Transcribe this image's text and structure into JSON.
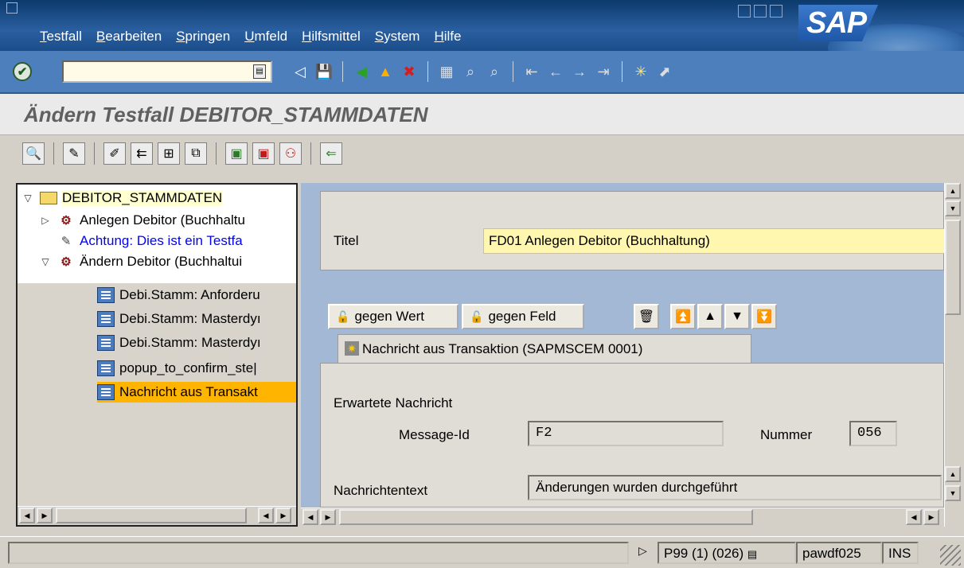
{
  "menu": [
    "Testfall",
    "Bearbeiten",
    "Springen",
    "Umfeld",
    "Hilfsmittel",
    "System",
    "Hilfe"
  ],
  "brand": "SAP",
  "command_field": {
    "value": ""
  },
  "page_title": "Ändern Testfall DEBITOR_STAMMDATEN",
  "tree": {
    "root": "DEBITOR_STAMMDATEN",
    "items": [
      {
        "label": "Anlegen Debitor (Buchhaltu",
        "icon": "gear-icon"
      },
      {
        "label": "Achtung: Dies ist ein Testfa",
        "icon": "pencil-icon",
        "color": "#0000ff"
      },
      {
        "label": "Ändern Debitor (Buchhaltui",
        "icon": "gear-icon"
      },
      {
        "label": "Debi.Stamm: Anforderu",
        "icon": "document-icon"
      },
      {
        "label": "Debi.Stamm: Masterdyı",
        "icon": "document-icon"
      },
      {
        "label": "Debi.Stamm: Masterdyı",
        "icon": "document-icon"
      },
      {
        "label": "popup_to_confirm_ste|",
        "icon": "document-icon"
      },
      {
        "label": "Nachricht aus Transakt",
        "icon": "document-icon",
        "selected": true
      }
    ]
  },
  "detail": {
    "titel_label": "Titel",
    "titel_value": "FD01 Anlegen Debitor (Buchhaltung)",
    "btn_gegen_wert": "gegen Wert",
    "btn_gegen_feld": "gegen Feld",
    "tab_label": "Nachricht aus Transaktion (SAPMSCEM 0001)",
    "erwartete_nachricht": "Erwartete Nachricht",
    "message_id_label": "Message-Id",
    "message_id_value": "F2",
    "nummer_label": "Nummer",
    "nummer_value": "056",
    "nachrichtentext_label": "Nachrichtentext",
    "nachrichtentext_value": "Änderungen wurden durchgeführt"
  },
  "status": {
    "system": "P99 (1) (026)",
    "server": "pawdf025",
    "mode": "INS"
  },
  "colors": {
    "selected_bg": "#ffb400",
    "title_field_bg": "#fff6b0",
    "panel_bg": "#a2b8d4"
  }
}
